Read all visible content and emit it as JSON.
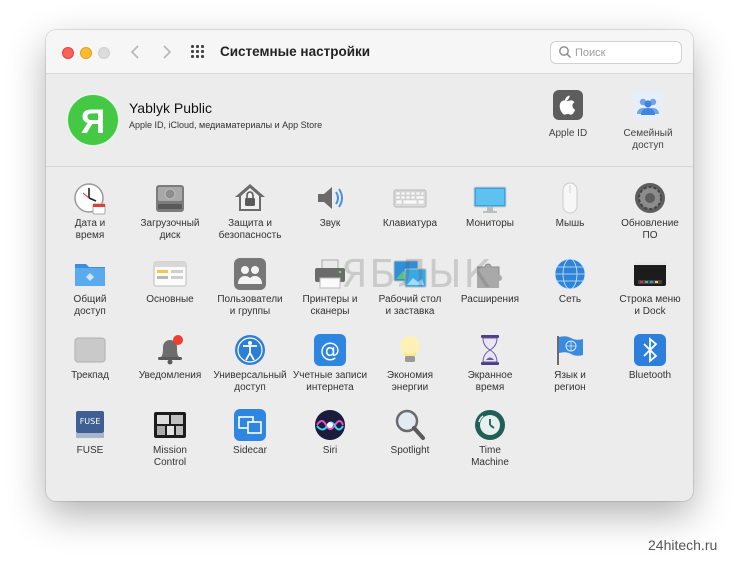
{
  "window": {
    "title": "Системные настройки",
    "search_placeholder": "Поиск"
  },
  "account": {
    "avatar_letter": "Я",
    "name": "Yablyk Public",
    "subtitle": "Apple ID, iCloud, медиаматериалы и App Store",
    "apple_id_label": "Apple ID",
    "family_label_1": "Семейный",
    "family_label_2": "доступ"
  },
  "panes": [
    {
      "icon": "clock-icon",
      "l1": "Дата и",
      "l2": "время"
    },
    {
      "icon": "disk-icon",
      "l1": "Загрузочный",
      "l2": "диск"
    },
    {
      "icon": "house-lock-icon",
      "l1": "Защита и",
      "l2": "безопасность"
    },
    {
      "icon": "speaker-icon",
      "l1": "Звук",
      "l2": ""
    },
    {
      "icon": "keyboard-icon",
      "l1": "Клавиатура",
      "l2": ""
    },
    {
      "icon": "monitor-icon",
      "l1": "Мониторы",
      "l2": ""
    },
    {
      "icon": "mouse-icon",
      "l1": "Мышь",
      "l2": ""
    },
    {
      "icon": "gear-icon",
      "l1": "Обновление",
      "l2": "ПО"
    },
    {
      "icon": "folder-icon",
      "l1": "Общий",
      "l2": "доступ"
    },
    {
      "icon": "window-icon",
      "l1": "Основные",
      "l2": ""
    },
    {
      "icon": "users-icon",
      "l1": "Пользователи",
      "l2": "и группы"
    },
    {
      "icon": "printer-icon",
      "l1": "Принтеры и",
      "l2": "сканеры"
    },
    {
      "icon": "desktop-icon",
      "l1": "Рабочий стол",
      "l2": "и заставка"
    },
    {
      "icon": "puzzle-icon",
      "l1": "Расширения",
      "l2": ""
    },
    {
      "icon": "globe-icon",
      "l1": "Сеть",
      "l2": ""
    },
    {
      "icon": "dock-icon",
      "l1": "Строка меню",
      "l2": "и Dock"
    },
    {
      "icon": "trackpad-icon",
      "l1": "Трекпад",
      "l2": ""
    },
    {
      "icon": "bell-icon",
      "l1": "Уведомления",
      "l2": ""
    },
    {
      "icon": "accessibility-icon",
      "l1": "Универсальный",
      "l2": "доступ"
    },
    {
      "icon": "at-icon",
      "l1": "Учетные записи",
      "l2": "интернета"
    },
    {
      "icon": "bulb-icon",
      "l1": "Экономия",
      "l2": "энергии"
    },
    {
      "icon": "hourglass-icon",
      "l1": "Экранное",
      "l2": "время"
    },
    {
      "icon": "flag-icon",
      "l1": "Язык и",
      "l2": "регион"
    },
    {
      "icon": "bluetooth-icon",
      "l1": "Bluetooth",
      "l2": ""
    },
    {
      "icon": "fuse-icon",
      "l1": "FUSE",
      "l2": ""
    },
    {
      "icon": "mission-control-icon",
      "l1": "Mission",
      "l2": "Control"
    },
    {
      "icon": "sidecar-icon",
      "l1": "Sidecar",
      "l2": ""
    },
    {
      "icon": "siri-icon",
      "l1": "Siri",
      "l2": ""
    },
    {
      "icon": "spotlight-icon",
      "l1": "Spotlight",
      "l2": ""
    },
    {
      "icon": "time-machine-icon",
      "l1": "Time",
      "l2": "Machine"
    }
  ],
  "watermark": "ЯБЛЫК",
  "credit": "24hitech.ru",
  "fuse_badge": "FUSE",
  "at_glyph": "@"
}
